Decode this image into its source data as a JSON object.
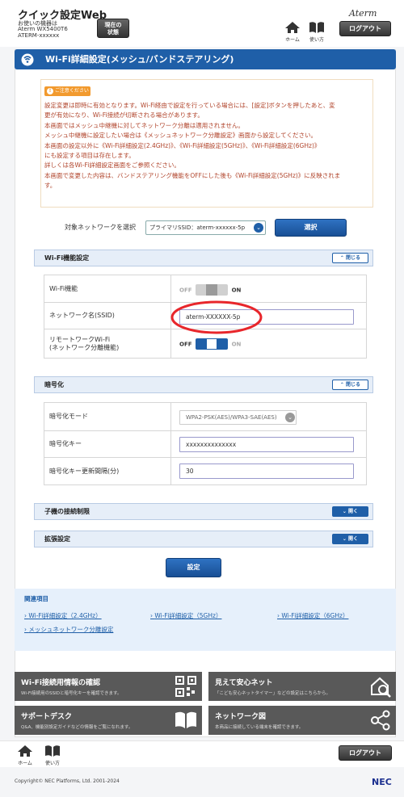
{
  "header": {
    "app_title": "クイック設定Web",
    "device_line1": "お使いの機器は",
    "device_line2": "Aterm WX5400T6",
    "device_line3": "ATERM-xxxxxx",
    "status_button_line1": "現在の",
    "status_button_line2": "状態",
    "brand_logo": "Aterm",
    "home_label": "ホーム",
    "usage_label": "使い方",
    "logout_label": "ログアウト"
  },
  "page": {
    "title": "Wi-Fi詳細設定(メッシュ/バンドステアリング)"
  },
  "caution": {
    "badge": "ご注意ください",
    "lines": [
      "設定変更は即時に有効となります。Wi-Fi経由で設定を行っている場合には、[設定]ボタンを押したあと、変",
      "更が有効になり、Wi-Fi接続が切断される場合があります。",
      "本画面ではメッシュ中継機に対してネットワーク分離は適用されません。",
      "メッシュ中継機に設定したい場合は《メッシュネットワーク分離設定》画面から設定してください。",
      "本画面の設定以外に《Wi-Fi詳細設定(2.4GHz)》、《Wi-Fi詳細設定(5GHz)》、《Wi-Fi詳細設定(6GHz)》",
      "にも設定する項目は存在します。",
      "詳しくは各Wi-Fi詳細設定画面をご参照ください。",
      "本画面で変更した内容は、バンドステアリング機能をOFFにした後も《Wi-Fi詳細設定(5GHz)》に反映されま",
      "す。"
    ]
  },
  "network_select": {
    "label": "対象ネットワークを選択",
    "value": "プライマリSSID：aterm-xxxxxx-5p",
    "button": "選択"
  },
  "wifi_section": {
    "title": "Wi-Fi機能設定",
    "toggle": "閉じる",
    "rows": {
      "wifi_function_label": "Wi-Fi機能",
      "wifi_off": "OFF",
      "wifi_on": "ON",
      "ssid_label": "ネットワーク名(SSID)",
      "ssid_value": "aterm-XXXXXX-5p",
      "remote_label_line1": "リモートワークWi-Fi",
      "remote_label_line2": "(ネットワーク分離機能)",
      "remote_off": "OFF",
      "remote_on": "ON"
    }
  },
  "encryption_section": {
    "title": "暗号化",
    "toggle": "閉じる",
    "rows": {
      "mode_label": "暗号化モード",
      "mode_value": "WPA2-PSK(AES)/WPA3-SAE(AES)",
      "key_label": "暗号化キー",
      "key_value": "xxxxxxxxxxxxxx",
      "interval_label": "暗号化キー更新間隔(分)",
      "interval_value": "30"
    }
  },
  "client_section": {
    "title": "子機の接続制限",
    "toggle": "開く"
  },
  "extended_section": {
    "title": "拡張設定",
    "toggle": "開く"
  },
  "setting_button": "設定",
  "related": {
    "title": "関連項目",
    "links": [
      "Wi-Fi詳細設定（2.4GHz）",
      "Wi-Fi詳細設定（5GHz）",
      "Wi-Fi詳細設定（6GHz）",
      "メッシュネットワーク分離設定"
    ]
  },
  "tiles": [
    {
      "title": "Wi-Fi接続用情報の確認",
      "sub": "Wi-Fi接続用のSSIDと暗号化キーを確認できます。",
      "icon": "qr-code-icon"
    },
    {
      "title": "見えて安心ネット",
      "sub": "「こども安心ネットタイマー」などの設定はこちらから。",
      "icon": "house-search-icon"
    },
    {
      "title": "サポートデスク",
      "sub": "Q&A、機能別設定ガイドなどの情報をご覧になれます。",
      "icon": "book-icon"
    },
    {
      "title": "ネットワーク図",
      "sub": "本商品に接続している端末を確認できます。",
      "icon": "network-icon"
    }
  ],
  "footer": {
    "home_label": "ホーム",
    "usage_label": "使い方",
    "logout_label": "ログアウト",
    "copyright": "Copyright© NEC Platforms, Ltd. 2001-2024",
    "brand": "NEC"
  },
  "colors": {
    "accent": "#1f5fa8",
    "caution_text": "#b0432a",
    "caution_badge": "#f29a2e",
    "annotation_circle": "#e8262b"
  }
}
